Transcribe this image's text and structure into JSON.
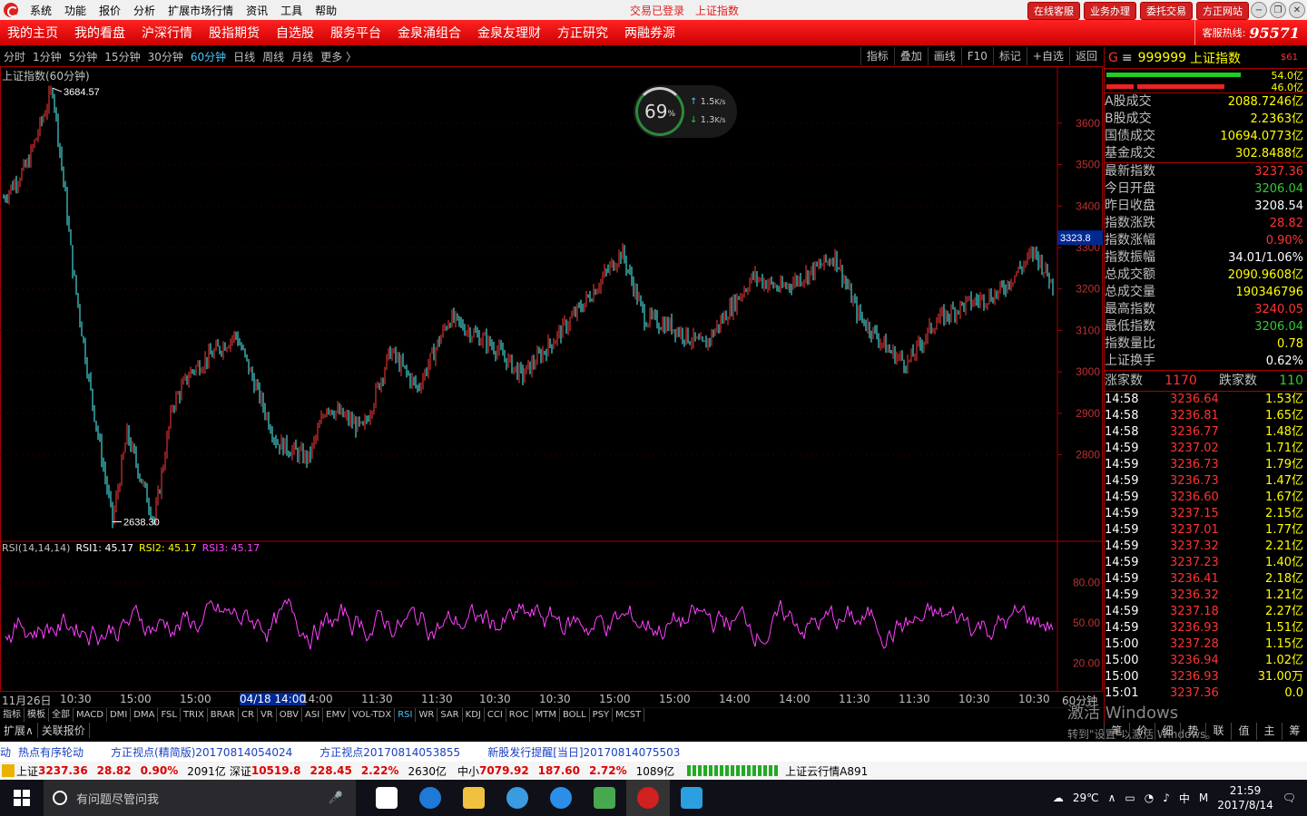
{
  "menu": {
    "items": [
      "系统",
      "功能",
      "报价",
      "分析",
      "扩展市场行情",
      "资讯",
      "工具",
      "帮助"
    ],
    "status": "交易已登录",
    "status2": "上证指数",
    "buttons": [
      "在线客服",
      "业务办理",
      "委托交易",
      "方正网站"
    ]
  },
  "nav": {
    "items": [
      "我的主页",
      "我的看盘",
      "沪深行情",
      "股指期货",
      "自选股",
      "服务平台",
      "金泉涌组合",
      "金泉友理财",
      "方正研究",
      "两融券源"
    ],
    "hotline_label": "客服热线:",
    "hotline_number": "95571"
  },
  "toolbar": {
    "periods": [
      "分时",
      "1分钟",
      "5分钟",
      "15分钟",
      "30分钟",
      "60分钟",
      "日线",
      "周线",
      "月线",
      "更多 〉"
    ],
    "active": "60分钟",
    "right": [
      "指标",
      "叠加",
      "画线",
      "F10",
      "标记",
      "+自选",
      "返回"
    ]
  },
  "chart": {
    "title": "上证指数(60分钟)",
    "high_label": "3684.57",
    "low_label": "2638.30",
    "cursor_price": "3323.8",
    "price_ticks": [
      "3600",
      "3500",
      "3400",
      "3300",
      "3200",
      "3100",
      "3000",
      "2900",
      "2800"
    ],
    "rsi_ticks": [
      "80.00",
      "50.00",
      "20.00"
    ],
    "time_labels": [
      "11月26日",
      "10:30",
      "15:00",
      "15:00",
      "04/18 14:00",
      "14:00",
      "11:30",
      "11:30",
      "10:30",
      "10:30",
      "15:00",
      "15:00",
      "14:00",
      "14:00",
      "11:30",
      "11:30",
      "10:30",
      "10:30"
    ],
    "period_label": "60分钟"
  },
  "chart_data": {
    "type": "candlestick",
    "title": "上证指数(60分钟)",
    "ylim": [
      2600,
      3720
    ],
    "high": 3684.57,
    "low": 2638.3,
    "rsi": {
      "name": "RSI(14,14,14)",
      "rsi1": "45.17",
      "rsi2": "45.17",
      "rsi3": "45.17",
      "ylim": [
        0,
        100
      ]
    }
  },
  "rsi_header": {
    "name": "RSI(14,14,14)",
    "r1_label": "RSI1:",
    "r1": "45.17",
    "r2_label": "RSI2:",
    "r2": "45.17",
    "r3_label": "RSI3:",
    "r3": "45.17"
  },
  "net": {
    "percent": "69",
    "unit": "%",
    "up": "1.5",
    "down": "1.3",
    "speed_unit": "K/s"
  },
  "indicator_tabs": [
    "指标",
    "模板",
    "全部",
    "MACD",
    "DMI",
    "DMA",
    "FSL",
    "TRIX",
    "BRAR",
    "CR",
    "VR",
    "OBV",
    "ASI",
    "EMV",
    "VOL-TDX",
    "RSI",
    "WR",
    "SAR",
    "KDJ",
    "CCI",
    "ROC",
    "MTM",
    "BOLL",
    "PSY",
    "MCST"
  ],
  "active_indicator": "RSI",
  "expand_tabs": [
    "扩展∧",
    "关联报价"
  ],
  "news": [
    "动",
    "热点有序轮动",
    "方正视点(精简版)20170814054024",
    "方正视点20170814053855",
    "新股发行提醒[当日]20170814075503"
  ],
  "status": {
    "sh_label": "上证",
    "sh": "3237.36",
    "sh_chg": "28.82",
    "sh_pct": "0.90%",
    "sh_amt": "2091亿",
    "sz_label": "深证",
    "sz": "10519.8",
    "sz_chg": "228.45",
    "sz_pct": "2.22%",
    "sz_amt": "2630亿",
    "zx_label": "中小",
    "zx": "7079.92",
    "zx_chg": "187.60",
    "zx_pct": "2.72%",
    "zx_amt": "1089亿",
    "cloud": "上证云行情A891"
  },
  "panel": {
    "g": "G",
    "code": "999999",
    "name": "上证指数",
    "sub": "$61",
    "bar1": "54.0亿",
    "bar2": "46.0亿",
    "turnover": [
      {
        "k": "A股成交",
        "v": "2088.7246亿"
      },
      {
        "k": "B股成交",
        "v": "2.2363亿"
      },
      {
        "k": "国债成交",
        "v": "10694.0773亿"
      },
      {
        "k": "基金成交",
        "v": "302.8488亿"
      }
    ],
    "stats": [
      {
        "k": "最新指数",
        "v": "3237.36",
        "c": "red"
      },
      {
        "k": "今日开盘",
        "v": "3206.04",
        "c": "green"
      },
      {
        "k": "昨日收盘",
        "v": "3208.54",
        "c": "white"
      },
      {
        "k": "指数涨跌",
        "v": "28.82",
        "c": "red"
      },
      {
        "k": "指数涨幅",
        "v": "0.90%",
        "c": "red"
      },
      {
        "k": "指数振幅",
        "v": "34.01/1.06%",
        "c": "white"
      },
      {
        "k": "总成交额",
        "v": "2090.9608亿",
        "c": "yellow"
      },
      {
        "k": "总成交量",
        "v": "190346796",
        "c": "yellow"
      },
      {
        "k": "最高指数",
        "v": "3240.05",
        "c": "red"
      },
      {
        "k": "最低指数",
        "v": "3206.04",
        "c": "green"
      },
      {
        "k": "指数量比",
        "v": "0.78",
        "c": "yellow"
      },
      {
        "k": "上证换手",
        "v": "0.62%",
        "c": "white"
      }
    ],
    "rise_label": "涨家数",
    "rise": "1170",
    "fall_label": "跌家数",
    "fall": "110",
    "ticks": [
      [
        "14:58",
        "3236.64",
        "1.53亿"
      ],
      [
        "14:58",
        "3236.81",
        "1.65亿"
      ],
      [
        "14:58",
        "3236.77",
        "1.48亿"
      ],
      [
        "14:59",
        "3237.02",
        "1.71亿"
      ],
      [
        "14:59",
        "3236.73",
        "1.79亿"
      ],
      [
        "14:59",
        "3236.73",
        "1.47亿"
      ],
      [
        "14:59",
        "3236.60",
        "1.67亿"
      ],
      [
        "14:59",
        "3237.15",
        "2.15亿"
      ],
      [
        "14:59",
        "3237.01",
        "1.77亿"
      ],
      [
        "14:59",
        "3237.32",
        "2.21亿"
      ],
      [
        "14:59",
        "3237.23",
        "1.40亿"
      ],
      [
        "14:59",
        "3236.41",
        "2.18亿"
      ],
      [
        "14:59",
        "3236.32",
        "1.21亿"
      ],
      [
        "14:59",
        "3237.18",
        "2.27亿"
      ],
      [
        "14:59",
        "3236.93",
        "1.51亿"
      ],
      [
        "15:00",
        "3237.28",
        "1.15亿"
      ],
      [
        "15:00",
        "3236.94",
        "1.02亿"
      ],
      [
        "15:00",
        "3236.93",
        "31.00万"
      ],
      [
        "15:01",
        "3237.36",
        "0.0"
      ]
    ],
    "foot": [
      "笔",
      "价",
      "细",
      "势",
      "联",
      "值",
      "主",
      "筹"
    ]
  },
  "watermark": {
    "line1": "激活 Windows",
    "line2": "转到\"设置\"以激活 Windows。"
  },
  "taskbar": {
    "search": "有问题尽管问我",
    "temp": "29℃",
    "ime": "中",
    "time": "21:59",
    "date": "2017/8/14"
  },
  "colors": {
    "up": "#ff3c3c",
    "down": "#54ffff",
    "rsi": "#ff40ff",
    "accent": "#e02020"
  }
}
